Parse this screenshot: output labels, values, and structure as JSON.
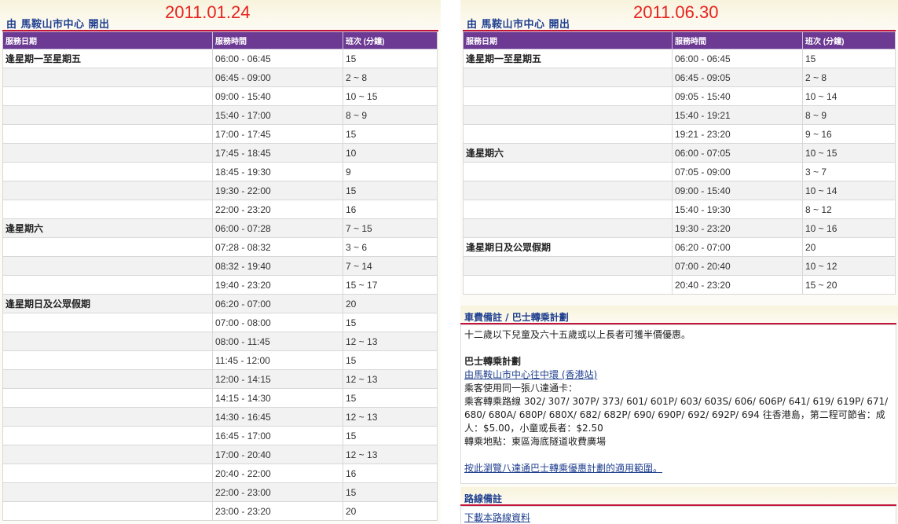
{
  "left": {
    "header_title": "由 馬鞍山市中心 開出",
    "date_stamp": "2011.01.24",
    "columns": [
      "服務日期",
      "服務時間",
      "班次 (分鐘)"
    ],
    "rows": [
      {
        "day": "逢星期一至星期五",
        "time": "06:00 - 06:45",
        "freq": "15"
      },
      {
        "day": "",
        "time": "06:45 - 09:00",
        "freq": "2 ~ 8"
      },
      {
        "day": "",
        "time": "09:00 - 15:40",
        "freq": "10 ~ 15"
      },
      {
        "day": "",
        "time": "15:40 - 17:00",
        "freq": "8 ~ 9"
      },
      {
        "day": "",
        "time": "17:00 - 17:45",
        "freq": "15"
      },
      {
        "day": "",
        "time": "17:45 - 18:45",
        "freq": "10"
      },
      {
        "day": "",
        "time": "18:45 - 19:30",
        "freq": "9"
      },
      {
        "day": "",
        "time": "19:30 - 22:00",
        "freq": "15"
      },
      {
        "day": "",
        "time": "22:00 - 23:20",
        "freq": "16"
      },
      {
        "day": "逢星期六",
        "time": "06:00 - 07:28",
        "freq": "7 ~ 15"
      },
      {
        "day": "",
        "time": "07:28 - 08:32",
        "freq": "3 ~ 6"
      },
      {
        "day": "",
        "time": "08:32 - 19:40",
        "freq": "7 ~ 14"
      },
      {
        "day": "",
        "time": "19:40 - 23:20",
        "freq": "15 ~ 17"
      },
      {
        "day": "逢星期日及公眾假期",
        "time": "06:20 - 07:00",
        "freq": "20"
      },
      {
        "day": "",
        "time": "07:00 - 08:00",
        "freq": "15"
      },
      {
        "day": "",
        "time": "08:00 - 11:45",
        "freq": "12 ~ 13"
      },
      {
        "day": "",
        "time": "11:45 - 12:00",
        "freq": "15"
      },
      {
        "day": "",
        "time": "12:00 - 14:15",
        "freq": "12 ~ 13"
      },
      {
        "day": "",
        "time": "14:15 - 14:30",
        "freq": "15"
      },
      {
        "day": "",
        "time": "14:30 - 16:45",
        "freq": "12 ~ 13"
      },
      {
        "day": "",
        "time": "16:45 - 17:00",
        "freq": "15"
      },
      {
        "day": "",
        "time": "17:00 - 20:40",
        "freq": "12 ~ 13"
      },
      {
        "day": "",
        "time": "20:40 - 22:00",
        "freq": "16"
      },
      {
        "day": "",
        "time": "22:00 - 23:00",
        "freq": "15"
      },
      {
        "day": "",
        "time": "23:00 - 23:20",
        "freq": "20"
      }
    ]
  },
  "right": {
    "header_title": "由 馬鞍山市中心 開出",
    "date_stamp": "2011.06.30",
    "columns": [
      "服務日期",
      "服務時間",
      "班次 (分鐘)"
    ],
    "rows": [
      {
        "day": "逢星期一至星期五",
        "time": "06:00 - 06:45",
        "freq": "15"
      },
      {
        "day": "",
        "time": "06:45 - 09:05",
        "freq": "2 ~ 8"
      },
      {
        "day": "",
        "time": "09:05 - 15:40",
        "freq": "10 ~ 14"
      },
      {
        "day": "",
        "time": "15:40 - 19:21",
        "freq": "8 ~ 9"
      },
      {
        "day": "",
        "time": "19:21 - 23:20",
        "freq": "9 ~ 16"
      },
      {
        "day": "逢星期六",
        "time": "06:00 - 07:05",
        "freq": "10 ~ 15"
      },
      {
        "day": "",
        "time": "07:05 - 09:00",
        "freq": "3 ~ 7"
      },
      {
        "day": "",
        "time": "09:00 - 15:40",
        "freq": "10 ~ 14"
      },
      {
        "day": "",
        "time": "15:40 - 19:30",
        "freq": "8 ~ 12"
      },
      {
        "day": "",
        "time": "19:30 - 23:20",
        "freq": "10 ~ 16"
      },
      {
        "day": "逢星期日及公眾假期",
        "time": "06:20 - 07:00",
        "freq": "20"
      },
      {
        "day": "",
        "time": "07:00 - 20:40",
        "freq": "10 ~ 12"
      },
      {
        "day": "",
        "time": "20:40 - 23:20",
        "freq": "15 ~ 20"
      }
    ],
    "fare_section": {
      "title": "車費備註 / 巴士轉乘計劃",
      "note": "十二歲以下兒童及六十五歲或以上長者可獲半價優惠。",
      "scheme_title": "巴士轉乘計劃",
      "scheme_link": "由馬鞍山市中心往中環 (香港站)",
      "line1": "乘客使用同一張八達通卡：",
      "line2": "乘客轉乘路線 302/ 307/ 307P/ 373/ 601/ 601P/ 603/ 603S/ 606/ 606P/ 641/ 619/ 619P/ 671/",
      "line3": "680/ 680A/ 680P/ 680X/ 682/ 682P/ 690/ 690P/ 692/ 692P/ 694 往香港島，第二程可節省：成",
      "line4": "人：$5.00，小童或長者：$2.50",
      "line5": "轉乘地點：東區海底隧道收費廣場",
      "octopus_link": "按此瀏覽八達通巴士轉乘優惠計劃的適用範圍。"
    },
    "route_section": {
      "title": "路線備註",
      "download_link": "下載本路線資料"
    }
  },
  "colors": {
    "header_purple": "#6c3a93",
    "accent_red": "#c3153b",
    "title_blue": "#1f3f8f",
    "date_red": "#e8221e"
  }
}
